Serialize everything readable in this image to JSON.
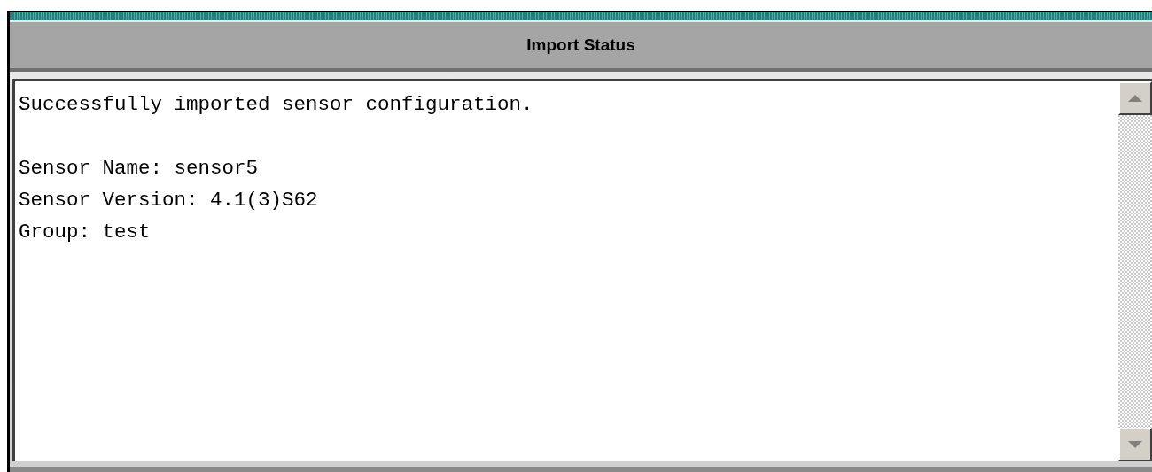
{
  "window": {
    "title": "Import Status"
  },
  "status_text": {
    "paragraphs": [
      [
        "Successfully imported sensor configuration."
      ],
      [
        "Sensor Name: sensor5",
        "Sensor Version: 4.1(3)S62",
        "Group: test"
      ]
    ]
  }
}
